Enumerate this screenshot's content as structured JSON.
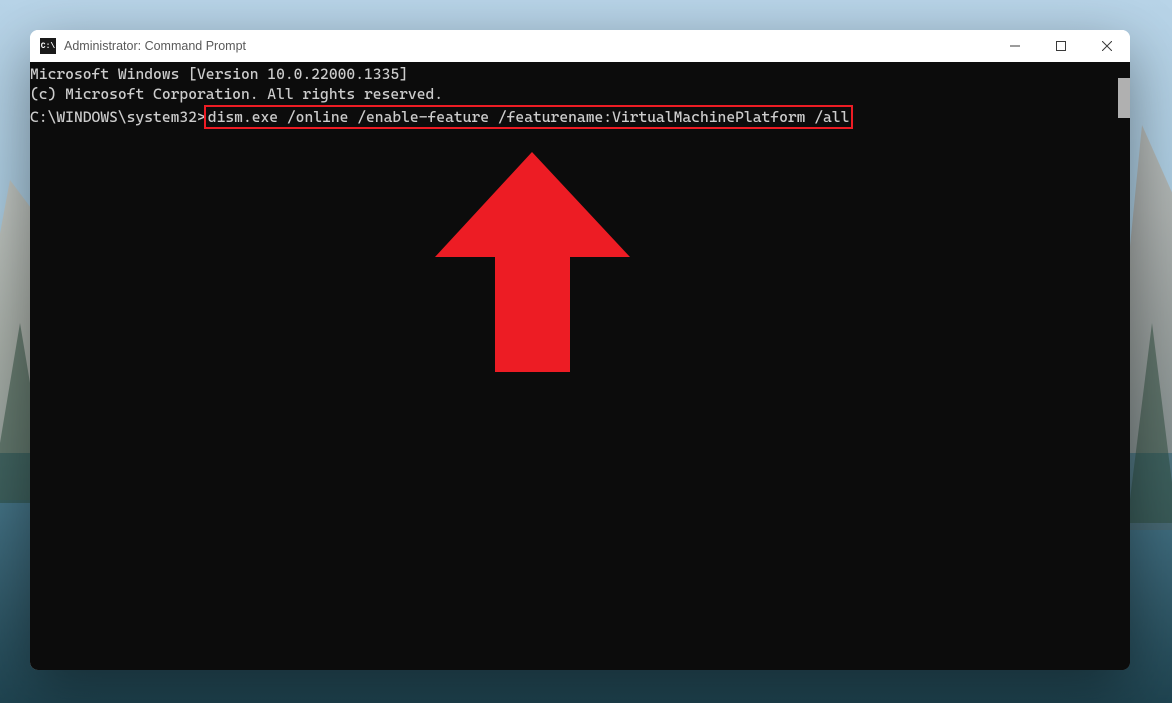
{
  "window": {
    "title": "Administrator: Command Prompt",
    "icon_label": "C:\\"
  },
  "terminal": {
    "line1": "Microsoft Windows [Version 10.0.22000.1335]",
    "line2": "(c) Microsoft Corporation. All rights reserved.",
    "blank": "",
    "prompt": "C:\\WINDOWS\\system32>",
    "command": "dism.exe /online /enable-feature /featurename:VirtualMachinePlatform /all"
  },
  "annotations": {
    "highlight_color": "#ed1c24"
  }
}
